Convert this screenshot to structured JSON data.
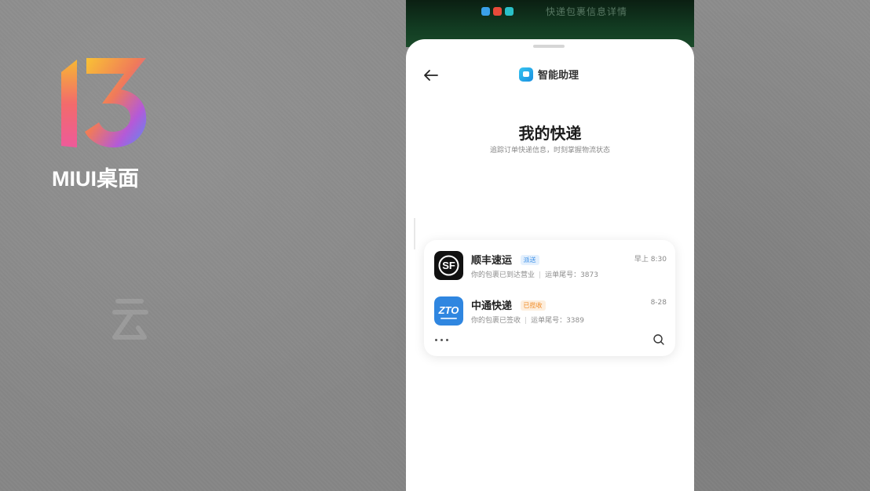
{
  "brand": {
    "logo_label": "MIUI桌面"
  },
  "status_bar": {
    "text": "快递包裹信息详情"
  },
  "assistant": {
    "app_name": "智能助理"
  },
  "page": {
    "title": "我的快递",
    "subtitle": "追踪订单快递信息，时刻掌握物流状态"
  },
  "parcels": [
    {
      "carrier": "顺丰速运",
      "badge": "派送",
      "badge_color": "#3a8ee6",
      "badge_bg": "#e4f0fd",
      "time": "早上 8:30",
      "status": "你的包裹已到达营业",
      "number_label": "运单尾号：3873",
      "logo_icon": "sf-express-logo-icon"
    },
    {
      "carrier": "中通快递",
      "badge": "已揽收",
      "badge_color": "#f08a24",
      "badge_bg": "#fdeedd",
      "time": "8-28",
      "status": "你的包裹已签收",
      "number_label": "运单尾号：3389",
      "logo_icon": "zto-express-logo-icon"
    }
  ],
  "colors": {
    "status_green": "#123c22",
    "assistant_blue": "#1a8fe0"
  }
}
